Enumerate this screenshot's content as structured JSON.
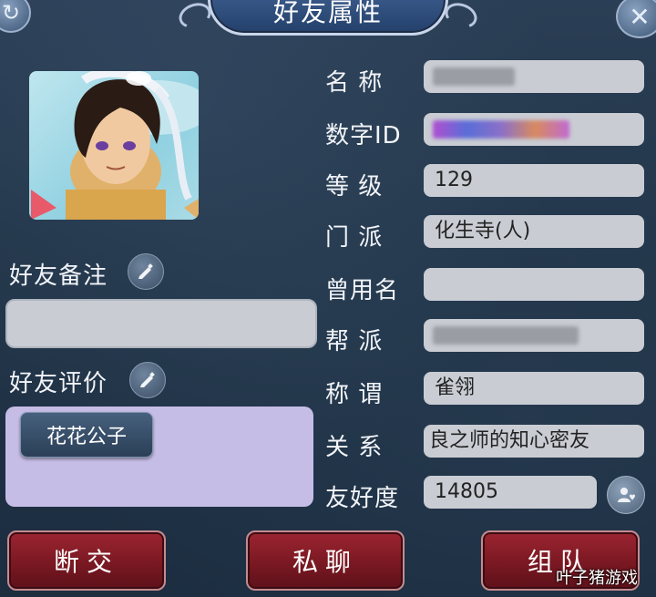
{
  "header": {
    "title": "好友属性"
  },
  "left": {
    "note_label": "好友备注",
    "note_value": "",
    "eval_label": "好友评价",
    "eval_tag": "花花公子"
  },
  "fields": {
    "name_label": "名 称",
    "id_label": "数字ID",
    "level_label": "等 级",
    "level_value": "129",
    "sect_label": "门 派",
    "sect_value": "化生寺(人)",
    "former_label": "曾用名",
    "former_value": "",
    "guild_label": "帮 派",
    "title_label": "称 谓",
    "title_value": "雀翎",
    "relation_label": "关 系",
    "relation_value": "良之师的知心密友",
    "friendship_label": "友好度",
    "friendship_value": "14805"
  },
  "actions": {
    "break_label": "断交",
    "chat_label": "私聊",
    "team_label": "组队"
  },
  "watermark": "叶子猪游戏",
  "icons": {
    "top_left": "refresh-icon",
    "top_right": "close-icon",
    "edit": "pencil-icon",
    "friendship": "user-heart-icon"
  },
  "colors": {
    "action_button": "#7a1822",
    "field_box": "#c9ccd3",
    "eval_box": "#c6bde6"
  }
}
